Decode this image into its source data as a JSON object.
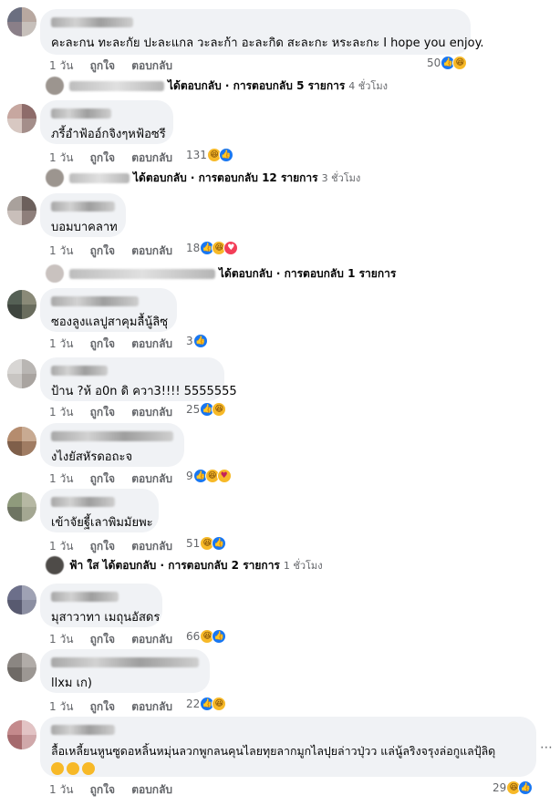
{
  "actions": {
    "like": "ถูกใจ",
    "reply": "ตอบกลับ"
  },
  "comments": [
    {
      "time": "1 วัน",
      "text": "คะละกน ทะละกัย ปะละแกล วะละก้า อะละกิด สะละกะ หระละกะ I hope you enjoy.",
      "reactions": "50",
      "icons": [
        "like-icon",
        "haha-icon"
      ]
    },
    {
      "time": "1 วัน",
      "text": "ภรี้อำฟ้ออ์กจิงๆหฟ้อซรี",
      "reactions": "131",
      "icons": [
        "haha-icon",
        "like-icon"
      ]
    },
    {
      "time": "1 วัน",
      "text": "บอมบาคลาท",
      "reactions": "18",
      "icons": [
        "like-icon",
        "haha-icon",
        "love-icon"
      ]
    },
    {
      "time": "1 วัน",
      "text": "ซองลูงแลปูสาคุมลื้นู้ลิซุ",
      "reactions": "3",
      "icons": [
        "like-icon"
      ]
    },
    {
      "time": "1 วัน",
      "text": "ป้าน ?ห้ อ0n ดิ ควา3!!!! 5555555",
      "reactions": "25",
      "icons": [
        "like-icon",
        "haha-icon"
      ]
    },
    {
      "time": "1 วัน",
      "text": "งไงยัสหัรดอถะจ",
      "reactions": "9",
      "icons": [
        "like-icon",
        "haha-icon",
        "care-icon"
      ]
    },
    {
      "time": "1 วัน",
      "text": "เข้าจัยฐี้เลาพิมมัยพะ",
      "reactions": "51",
      "icons": [
        "haha-icon",
        "like-icon"
      ]
    },
    {
      "time": "1 วัน",
      "text": "มุสาวาทา เมถุนอัสดร",
      "reactions": "66",
      "icons": [
        "haha-icon",
        "like-icon"
      ]
    },
    {
      "time": "1 วัน",
      "text": "llxม เก)",
      "reactions": "22",
      "icons": [
        "like-icon",
        "haha-icon"
      ]
    },
    {
      "time": "1 วัน",
      "text": "ลื้อเหลี้ยนหูนซูดอหลิ้นหมุ่นลวกพูกลนคุนไลยทุยลากมูกไลปุยล่าวปุ่วว แล่นู้ลริงจรุงล่อกูแลปุ้ลิดุ",
      "reactions": "29",
      "icons": [
        "haha-icon",
        "like-icon"
      ]
    }
  ],
  "replies": [
    {
      "name": "",
      "text": "ได้ตอบกลับ · การตอบกลับ 5 รายการ",
      "ago": "4 ชั่วโมง"
    },
    {
      "name": "",
      "text": "ได้ตอบกลับ · การตอบกลับ 12 รายการ",
      "ago": "3 ชั่วโมง"
    },
    {
      "name": "",
      "text": "ได้ตอบกลับ · การตอบกลับ 1 รายการ",
      "ago": ""
    },
    {
      "name": "ฟ้า ใส",
      "text": "ได้ตอบกลับ · การตอบกลับ 2 รายการ",
      "ago": "1 ชั่วโมง"
    }
  ],
  "more_icon": "ellipsis-icon"
}
